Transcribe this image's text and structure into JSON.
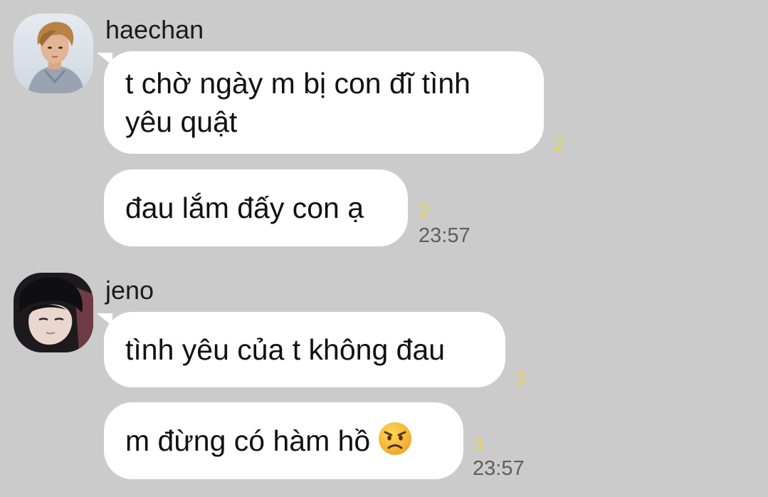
{
  "colors": {
    "background": "#cbcbcb",
    "bubble": "#ffffff",
    "unread_count": "#e8d25a",
    "timestamp": "#5e5e5e"
  },
  "groups": [
    {
      "sender": "haechan",
      "avatar_icon": "profile-photo",
      "messages": [
        {
          "lines": [
            "t chờ ngày m bị con đĩ tình",
            "yêu quật"
          ],
          "unread": "2"
        },
        {
          "text": "đau lắm đấy con ạ",
          "unread": "2",
          "time": "23:57"
        }
      ]
    },
    {
      "sender": "jeno",
      "avatar_icon": "profile-photo",
      "messages": [
        {
          "text": "tình yêu của t không đau",
          "unread": "3"
        },
        {
          "text": "m đừng có hàm hồ",
          "emoji": "angry-face-emoji",
          "unread": "3",
          "time": "23:57"
        }
      ]
    }
  ]
}
